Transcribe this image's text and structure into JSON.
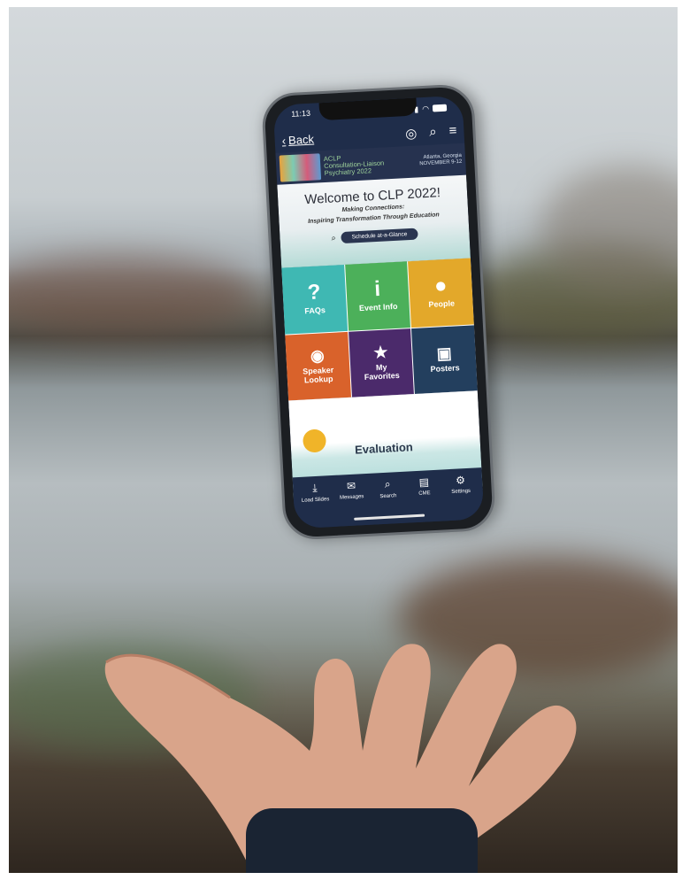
{
  "status": {
    "time": "11:13"
  },
  "topbar": {
    "back_label": "Back"
  },
  "banner": {
    "org": "ACLP",
    "title_line1": "Consultation-Liaison",
    "title_line2": "Psychiatry 2022",
    "location": "Atlanta, Georgia",
    "dates": "NOVEMBER 9-12"
  },
  "welcome": {
    "title": "Welcome to CLP 2022!",
    "tagline1": "Making Connections:",
    "tagline2": "Inspiring Transformation Through Education",
    "schedule_label": "Schedule at-a-Glance"
  },
  "tiles": [
    {
      "label": "FAQs",
      "icon": "question-icon",
      "color": "#3fb8b3"
    },
    {
      "label": "Event Info",
      "icon": "info-icon",
      "color": "#4cb05a"
    },
    {
      "label": "People",
      "icon": "person-icon",
      "color": "#e3a82a"
    },
    {
      "label": "Speaker Lookup",
      "icon": "speaker-icon",
      "color": "#d9622b"
    },
    {
      "label": "My Favorites",
      "icon": "star-icon",
      "color": "#4b2a6b"
    },
    {
      "label": "Posters",
      "icon": "poster-icon",
      "color": "#233f5e"
    }
  ],
  "evaluation": {
    "label": "Evaluation"
  },
  "tabbar": [
    {
      "label": "Load Slides",
      "icon": "download-icon"
    },
    {
      "label": "Messages",
      "icon": "chat-icon"
    },
    {
      "label": "Search",
      "icon": "search-icon"
    },
    {
      "label": "CME",
      "icon": "cme-icon"
    },
    {
      "label": "Settings",
      "icon": "gear-icon"
    }
  ]
}
